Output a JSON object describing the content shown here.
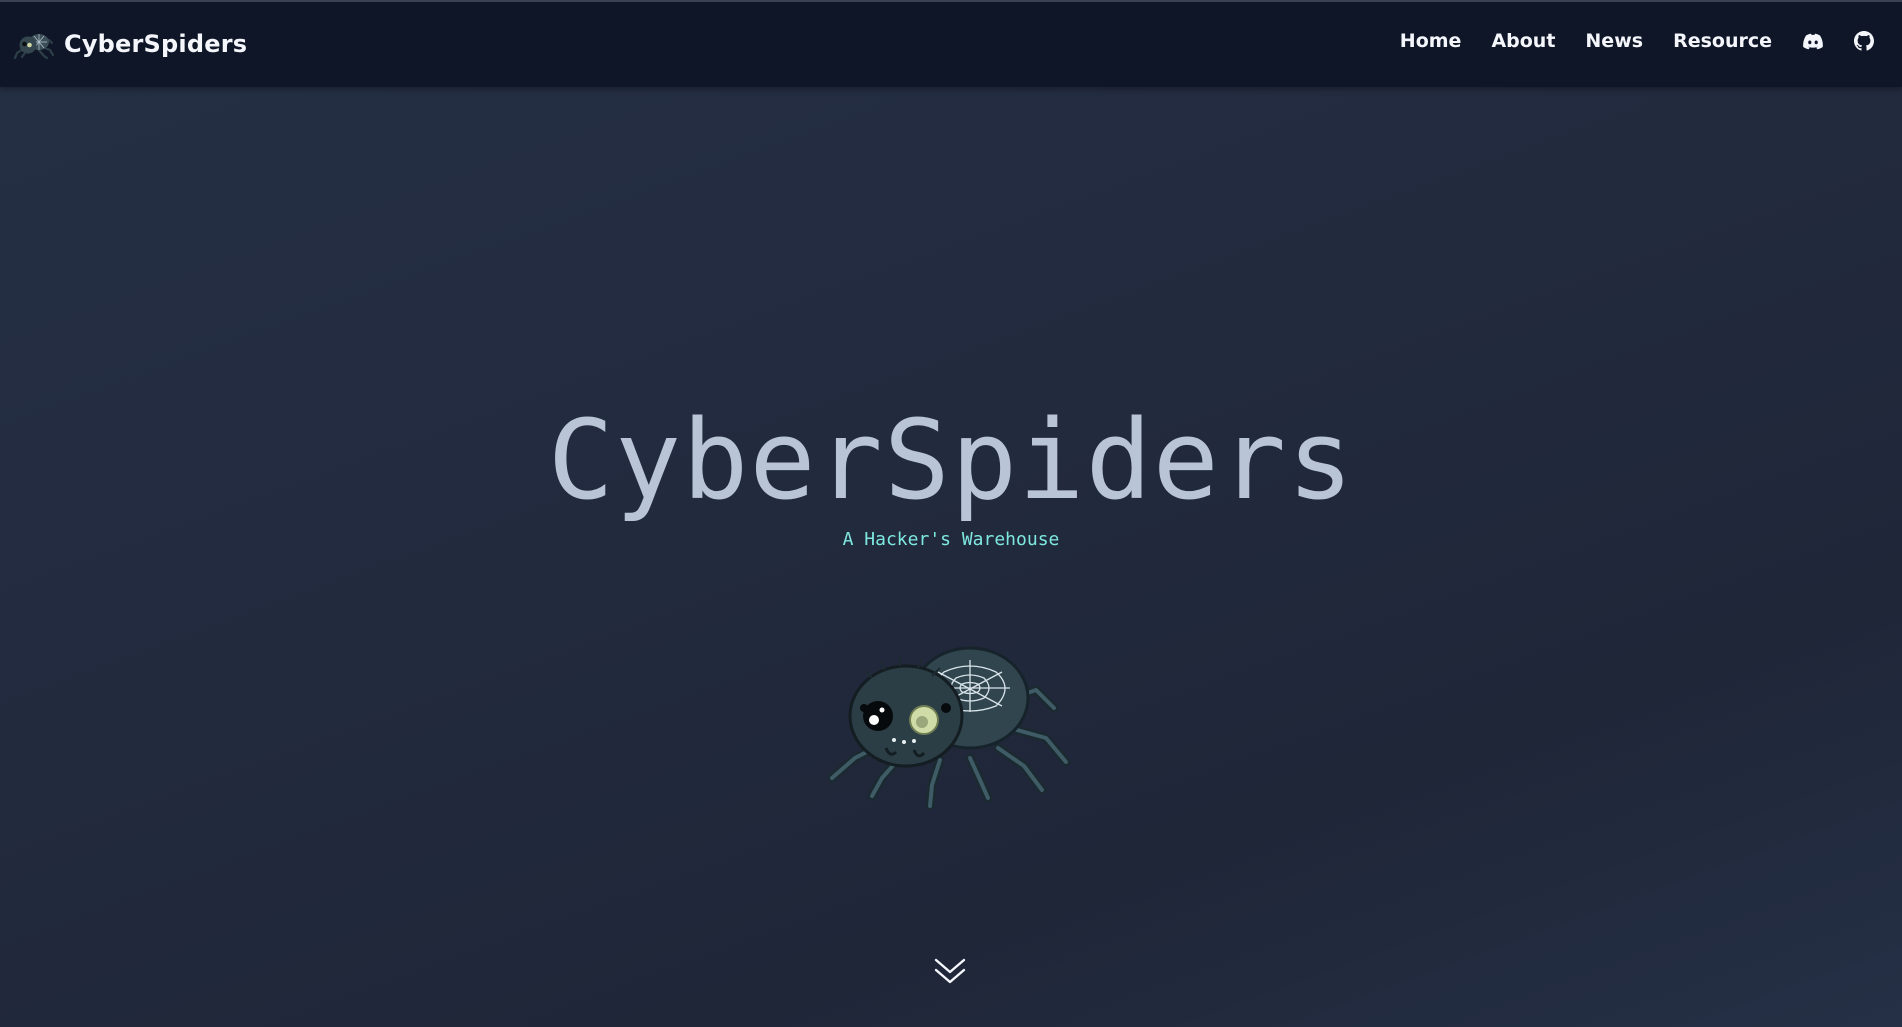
{
  "header": {
    "brand_name": "CyberSpiders",
    "nav": [
      {
        "label": "Home"
      },
      {
        "label": "About"
      },
      {
        "label": "News"
      },
      {
        "label": "Resource"
      }
    ],
    "icons": [
      "discord-icon",
      "github-icon"
    ]
  },
  "hero": {
    "title": "CyberSpiders",
    "subtitle": "A Hacker's Warehouse",
    "scroll_icon": "double-chevron-down-icon"
  },
  "colors": {
    "header_bg": "#0e1628",
    "page_bg": "#222b3f",
    "title": "#b9c4d6",
    "subtitle": "#7ee8e0",
    "nav_text": "#f4f6fb"
  }
}
